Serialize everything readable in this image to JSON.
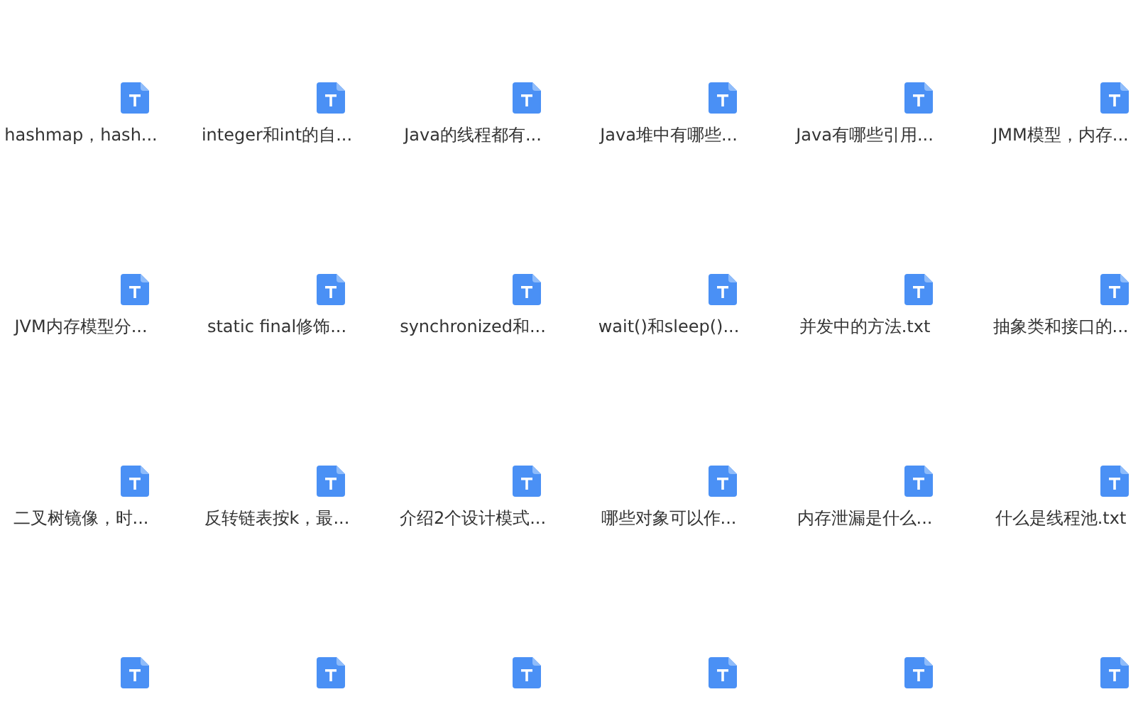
{
  "files": [
    {
      "label": "hashmap，hash..."
    },
    {
      "label": "integer和int的自..."
    },
    {
      "label": "Java的线程都有..."
    },
    {
      "label": "Java堆中有哪些..."
    },
    {
      "label": "Java有哪些引用..."
    },
    {
      "label": "JMM模型，内存..."
    },
    {
      "label": "JVM内存模型分..."
    },
    {
      "label": "static final修饰..."
    },
    {
      "label": "synchronized和..."
    },
    {
      "label": "wait()和sleep()..."
    },
    {
      "label": "并发中的方法.txt"
    },
    {
      "label": "抽象类和接口的..."
    },
    {
      "label": "二叉树镜像，时..."
    },
    {
      "label": "反转链表按k，最..."
    },
    {
      "label": "介绍2个设计模式..."
    },
    {
      "label": "哪些对象可以作..."
    },
    {
      "label": "内存泄漏是什么..."
    },
    {
      "label": "什么是线程池.txt"
    }
  ],
  "next_row_cut_off": true
}
